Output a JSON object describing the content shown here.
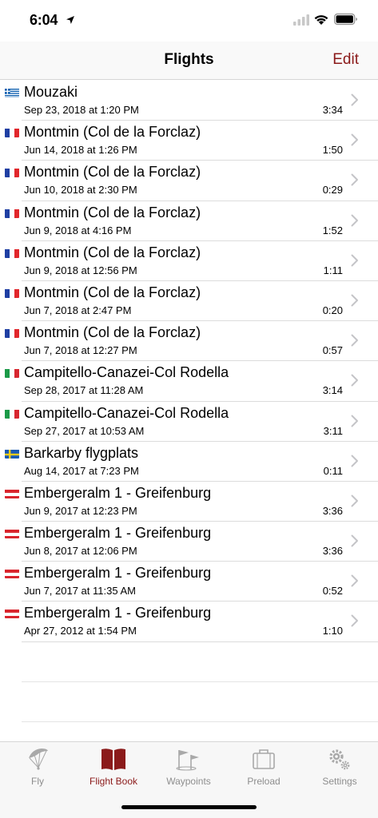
{
  "status": {
    "time": "6:04"
  },
  "nav": {
    "title": "Flights",
    "edit_label": "Edit"
  },
  "colors": {
    "accent": "#8b1a1a",
    "inactive": "#8e8e8e"
  },
  "flights": [
    {
      "flag": "GR",
      "site": "Mouzaki",
      "date": "Sep 23, 2018 at 1:20 PM",
      "duration": "3:34"
    },
    {
      "flag": "FR",
      "site": "Montmin (Col de la Forclaz)",
      "date": "Jun 14, 2018 at 1:26 PM",
      "duration": "1:50"
    },
    {
      "flag": "FR",
      "site": "Montmin (Col de la Forclaz)",
      "date": "Jun 10, 2018 at 2:30 PM",
      "duration": "0:29"
    },
    {
      "flag": "FR",
      "site": "Montmin (Col de la Forclaz)",
      "date": "Jun 9, 2018 at 4:16 PM",
      "duration": "1:52"
    },
    {
      "flag": "FR",
      "site": "Montmin (Col de la Forclaz)",
      "date": "Jun 9, 2018 at 12:56 PM",
      "duration": "1:11"
    },
    {
      "flag": "FR",
      "site": "Montmin (Col de la Forclaz)",
      "date": "Jun 7, 2018 at 2:47 PM",
      "duration": "0:20"
    },
    {
      "flag": "FR",
      "site": "Montmin (Col de la Forclaz)",
      "date": "Jun 7, 2018 at 12:27 PM",
      "duration": "0:57"
    },
    {
      "flag": "IT",
      "site": "Campitello-Canazei-Col Rodella",
      "date": "Sep 28, 2017 at 11:28 AM",
      "duration": "3:14"
    },
    {
      "flag": "IT",
      "site": "Campitello-Canazei-Col Rodella",
      "date": "Sep 27, 2017 at 10:53 AM",
      "duration": "3:11"
    },
    {
      "flag": "SE",
      "site": "Barkarby flygplats",
      "date": "Aug 14, 2017 at 7:23 PM",
      "duration": "0:11"
    },
    {
      "flag": "AT",
      "site": "Embergeralm 1 - Greifenburg",
      "date": "Jun 9, 2017 at 12:23 PM",
      "duration": "3:36"
    },
    {
      "flag": "AT",
      "site": "Embergeralm 1 - Greifenburg",
      "date": "Jun 8, 2017 at 12:06 PM",
      "duration": "3:36"
    },
    {
      "flag": "AT",
      "site": "Embergeralm 1 - Greifenburg",
      "date": "Jun 7, 2017 at 11:35 AM",
      "duration": "0:52"
    },
    {
      "flag": "AT",
      "site": "Embergeralm 1 - Greifenburg",
      "date": "Apr 27, 2012 at 1:54 PM",
      "duration": "1:10"
    }
  ],
  "tabs": [
    {
      "label": "Fly",
      "icon": "paraglider-icon",
      "active": false
    },
    {
      "label": "Flight Book",
      "icon": "book-icon",
      "active": true
    },
    {
      "label": "Waypoints",
      "icon": "waypoint-flags-icon",
      "active": false
    },
    {
      "label": "Preload",
      "icon": "suitcase-icon",
      "active": false
    },
    {
      "label": "Settings",
      "icon": "gears-icon",
      "active": false
    }
  ]
}
